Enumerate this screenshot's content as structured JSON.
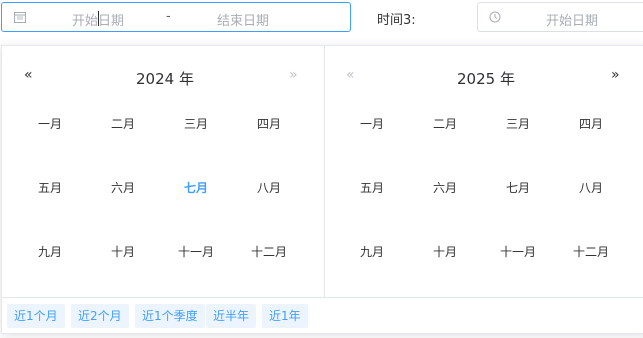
{
  "range_picker": {
    "start_placeholder": "开始日期",
    "separator": "-",
    "end_placeholder": "结束日期"
  },
  "time_label": "时间3:",
  "second_picker": {
    "start_placeholder": "开始日期"
  },
  "left_panel": {
    "year": "2024 年",
    "months": [
      "一月",
      "二月",
      "三月",
      "四月",
      "五月",
      "六月",
      "七月",
      "八月",
      "九月",
      "十月",
      "十一月",
      "十二月"
    ],
    "current_month_index": 6
  },
  "right_panel": {
    "year": "2025 年",
    "months": [
      "一月",
      "二月",
      "三月",
      "四月",
      "五月",
      "六月",
      "七月",
      "八月",
      "九月",
      "十月",
      "十一月",
      "十二月"
    ]
  },
  "shortcuts": [
    "近1个月",
    "近2个月",
    "近1个季度",
    "近半年",
    "近1年"
  ],
  "colors": {
    "accent": "#409eff",
    "shortcut_bg": "#ecf5ff",
    "placeholder": "#a9adb5",
    "border": "#dcdfe6"
  },
  "icons": {
    "range_input": "calendar-icon",
    "second_input": "clock-icon",
    "prev": "double-left-icon",
    "next": "double-right-icon"
  }
}
